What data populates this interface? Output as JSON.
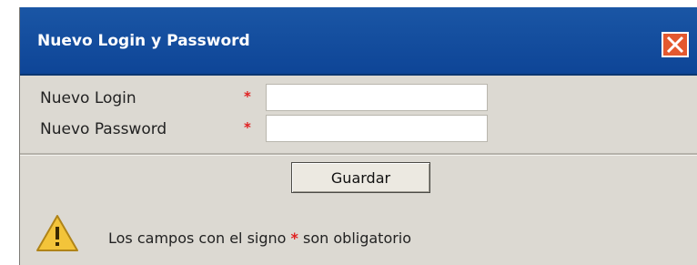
{
  "dialog": {
    "title": "Nuevo Login y Password",
    "close_label": "×"
  },
  "form": {
    "login_label": "Nuevo Login",
    "password_label": "Nuevo Password",
    "required_marker": "*",
    "login_value": "",
    "password_value": ""
  },
  "actions": {
    "save_label": "Guardar"
  },
  "notice": {
    "prefix": "Los campos con el signo",
    "marker": "*",
    "suffix": "son obligatorio",
    "icon": "warning-icon"
  },
  "colors": {
    "titlebar": "#1a56a5",
    "dialog_bg": "#dcd9d2",
    "required": "#e02020",
    "close": "#e4582e",
    "warning": "#f3c43a"
  }
}
